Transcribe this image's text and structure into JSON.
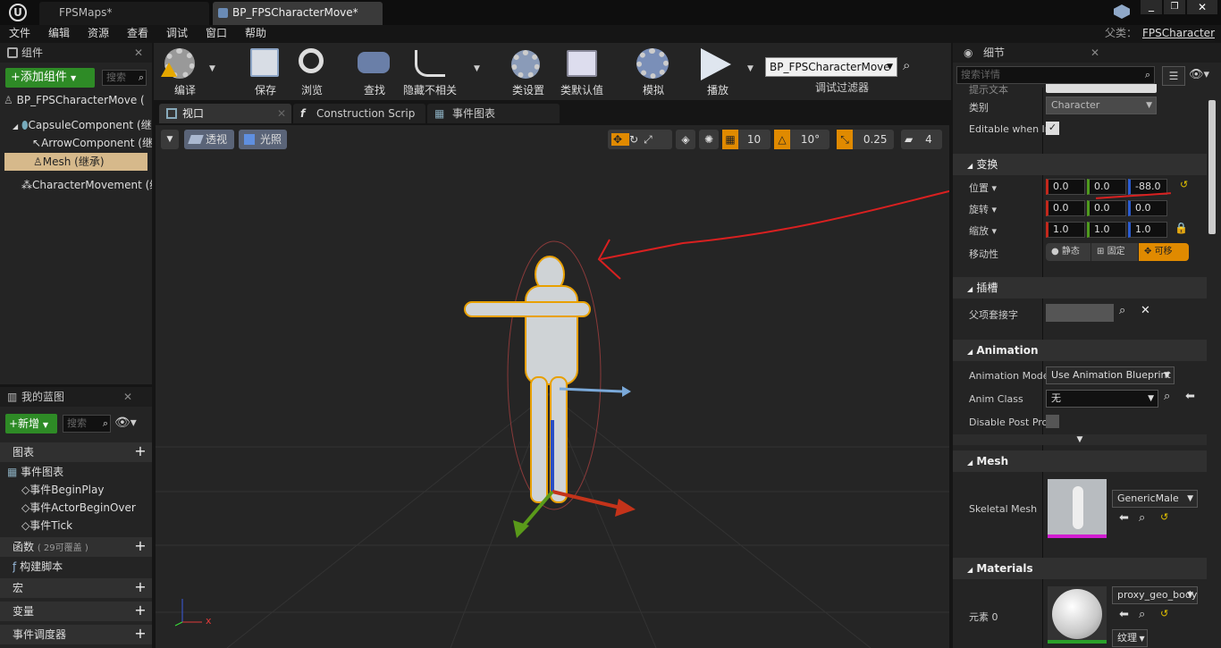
{
  "tabs": {
    "maps": "FPSMaps*",
    "character": "BP_FPSCharacterMove*"
  },
  "menu": [
    "文件",
    "编辑",
    "资源",
    "查看",
    "调试",
    "窗口",
    "帮助"
  ],
  "parent": {
    "label": "父类：",
    "value": "FPSCharacter"
  },
  "components": {
    "title": "组件",
    "add": "+添加组件",
    "search": "搜索",
    "root": "BP_FPSCharacterMove (",
    "items": [
      "CapsuleComponent (继",
      "ArrowComponent (继",
      "Mesh (继承)",
      "CharacterMovement (继"
    ]
  },
  "toolbar": {
    "buttons": [
      "编译",
      "保存",
      "浏览",
      "查找",
      "隐藏不相关",
      "类设置",
      "类默认值",
      "模拟",
      "播放"
    ],
    "debug_select": "BP_FPSCharacterMove",
    "debug_filter": "调试过滤器"
  },
  "editor_tabs": [
    "视口",
    "Construction Scrip",
    "事件图表"
  ],
  "viewport": {
    "perspective": "透视",
    "lighting": "光照",
    "grid": "10",
    "rot": "10°",
    "scale": "0.25",
    "speed": "4",
    "axis_x": "x"
  },
  "blueprint": {
    "title": "我的蓝图",
    "new": "+新增",
    "search": "搜索",
    "graphs": "图表",
    "event_graph": "事件图表",
    "events": [
      "事件BeginPlay",
      "事件ActorBeginOver",
      "事件Tick"
    ],
    "functions": "函数",
    "functions_note": "( 29可覆盖 )",
    "construct": "构建脚本",
    "macros": "宏",
    "variables": "变量",
    "dispatchers": "事件调度器"
  },
  "details": {
    "title": "细节",
    "search": "搜索详情",
    "tooltip_row": "提示文本",
    "category_label": "类别",
    "category_value": "Character",
    "editable_label": "Editable when In",
    "transform": "变换",
    "location": "位置",
    "rotation": "旋转",
    "scale": "缩放",
    "mobility": "移动性",
    "loc": [
      "0.0",
      "0.0",
      "-88.0"
    ],
    "rot": [
      "0.0",
      "0.0",
      "0.0"
    ],
    "scl": [
      "1.0",
      "1.0",
      "1.0"
    ],
    "mob": [
      "静态",
      "固定",
      "可移"
    ],
    "sockets": "插槽",
    "parent_socket": "父项套接字",
    "animation": "Animation",
    "anim_mode_label": "Animation Mode",
    "anim_mode": "Use Animation Blueprint",
    "anim_class_label": "Anim Class",
    "anim_class": "无",
    "disable_post": "Disable Post Pro",
    "mesh": "Mesh",
    "skeletal_label": "Skeletal Mesh",
    "skeletal_value": "GenericMale",
    "materials": "Materials",
    "element0": "元素 0",
    "material_value": "proxy_geo_body_",
    "texture": "纹理"
  }
}
